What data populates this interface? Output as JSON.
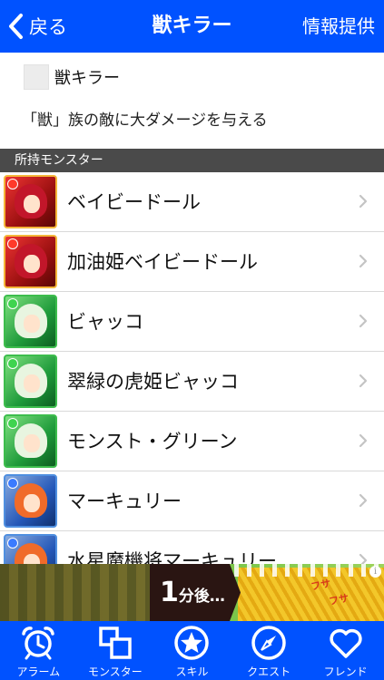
{
  "nav": {
    "back_label": "戻る",
    "title": "獣キラー",
    "right_label": "情報提供"
  },
  "skill": {
    "name": "獣キラー",
    "description": "「獣」族の敵に大ダメージを与える"
  },
  "section": {
    "title": "所持モンスター"
  },
  "monsters": [
    {
      "name": "ベイビードール",
      "color": "red"
    },
    {
      "name": "加油姫ベイビードール",
      "color": "red"
    },
    {
      "name": "ビャッコ",
      "color": "green"
    },
    {
      "name": "翠緑の虎姫ビャッコ",
      "color": "green"
    },
    {
      "name": "モンスト・グリーン",
      "color": "green"
    },
    {
      "name": "マーキュリー",
      "color": "blue"
    },
    {
      "name": "水星魔機将マーキュリー",
      "color": "blue"
    }
  ],
  "ad": {
    "num": "1",
    "rest": "分後…",
    "fusa1": "フサ",
    "fusa2": "フサ",
    "info": "i"
  },
  "tabs": [
    {
      "label": "アラーム",
      "icon": "alarm-clock-icon"
    },
    {
      "label": "モンスター",
      "icon": "monster-cards-icon"
    },
    {
      "label": "スキル",
      "icon": "star-icon"
    },
    {
      "label": "クエスト",
      "icon": "compass-icon"
    },
    {
      "label": "フレンド",
      "icon": "heart-icon"
    }
  ],
  "colors": {
    "nav_blue": "#0052ff",
    "section_gray": "#4a4a4a"
  }
}
